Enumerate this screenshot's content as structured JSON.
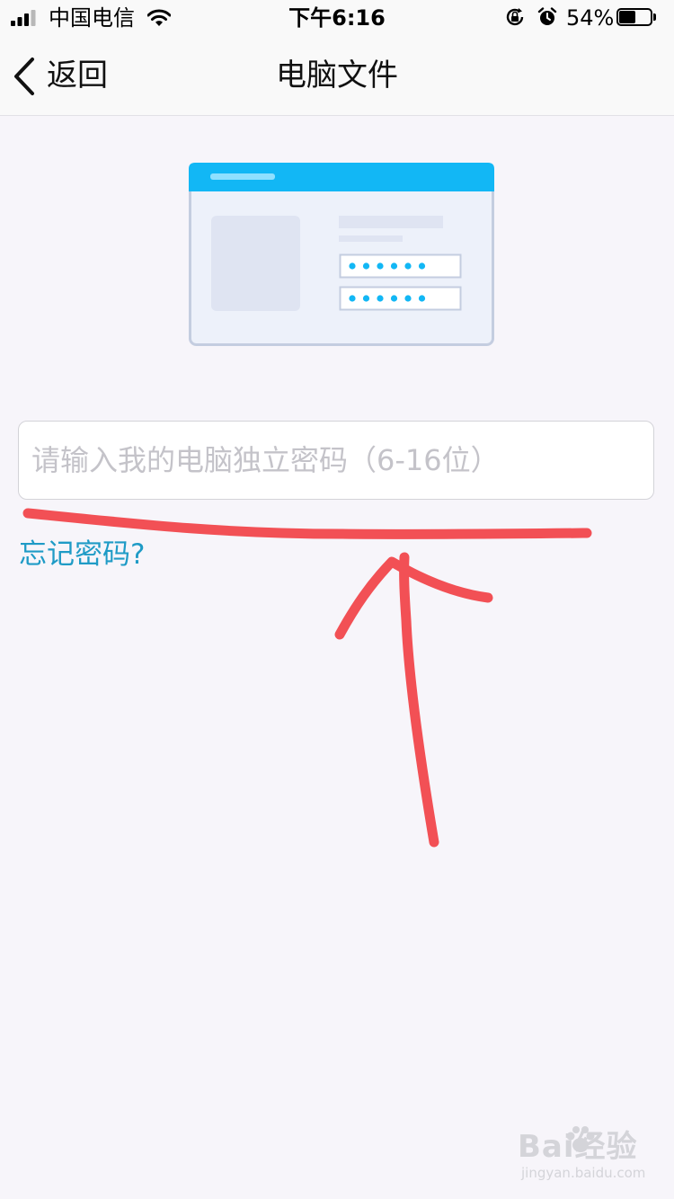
{
  "status_bar": {
    "carrier": "中国电信",
    "time": "下午6:16",
    "battery_percent": "54%",
    "battery_level": 0.54,
    "icons": [
      "signal-icon",
      "wifi-icon",
      "rotation-lock-icon",
      "alarm-icon",
      "battery-icon"
    ]
  },
  "nav": {
    "back_label": "返回",
    "title": "电脑文件"
  },
  "illustration": {
    "accent_color": "#12b7f5",
    "password_dot_count": 6
  },
  "form": {
    "password_placeholder": "请输入我的电脑独立密码（6-16位）",
    "password_value": "",
    "forgot_label": "忘记密码?"
  },
  "annotation": {
    "color": "#f25055",
    "shapes": [
      "underline-stroke",
      "up-arrow"
    ]
  },
  "watermark": {
    "brand": "Bai经验",
    "sub": "jingyan.baidu.com"
  },
  "colors": {
    "background": "#f7f5fa",
    "link": "#1f9bc6",
    "placeholder": "#c4c3c9"
  }
}
